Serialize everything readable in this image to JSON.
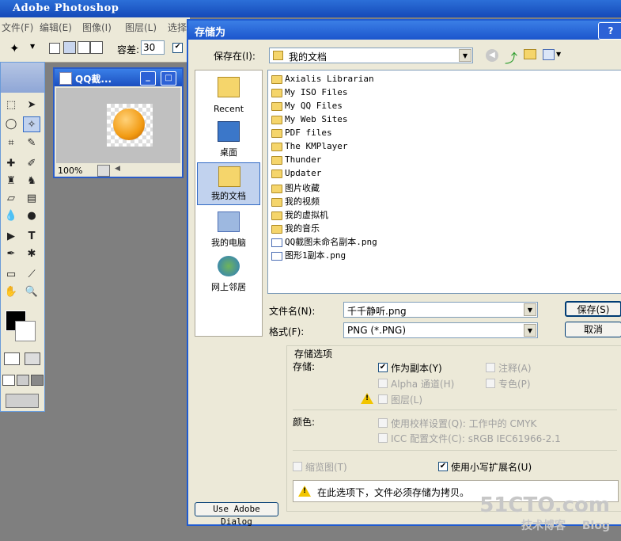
{
  "app": {
    "title": "Adobe Photoshop",
    "menu": [
      "文件(F)",
      "编辑(E)",
      "图像(I)",
      "图层(L)",
      "选择"
    ],
    "options": {
      "tolerance_label": "容差:",
      "tolerance_value": "30"
    }
  },
  "document_window": {
    "title": "QQ截...",
    "zoom": "100%"
  },
  "dialog": {
    "title": "存储为",
    "help_button": "?",
    "save_in_label": "保存在(I):",
    "save_in_value": "我的文档",
    "places": [
      {
        "label": "Recent",
        "icon": "recent-folder-icon"
      },
      {
        "label": "桌面",
        "icon": "desktop-icon"
      },
      {
        "label": "我的文档",
        "icon": "my-documents-icon"
      },
      {
        "label": "我的电脑",
        "icon": "my-computer-icon"
      },
      {
        "label": "网上邻居",
        "icon": "network-places-icon"
      }
    ],
    "files": [
      {
        "name": "Axialis Librarian",
        "type": "folder"
      },
      {
        "name": "My ISO Files",
        "type": "folder"
      },
      {
        "name": "My QQ Files",
        "type": "folder"
      },
      {
        "name": "My Web Sites",
        "type": "folder"
      },
      {
        "name": "PDF files",
        "type": "folder"
      },
      {
        "name": "The KMPlayer",
        "type": "folder"
      },
      {
        "name": "Thunder",
        "type": "folder"
      },
      {
        "name": "Updater",
        "type": "folder"
      },
      {
        "name": "图片收藏",
        "type": "folder"
      },
      {
        "name": "我的视频",
        "type": "folder"
      },
      {
        "name": "我的虚拟机",
        "type": "folder"
      },
      {
        "name": "我的音乐",
        "type": "folder"
      },
      {
        "name": "QQ截图未命名副本.png",
        "type": "png"
      },
      {
        "name": "图形1副本.png",
        "type": "png"
      }
    ],
    "filename_label": "文件名(N):",
    "filename_value": "千千静听.png",
    "format_label": "格式(F):",
    "format_value": "PNG (*.PNG)",
    "save_button": "保存(S)",
    "cancel_button": "取消",
    "options_group_title": "存储选项",
    "save_label": "存储:",
    "opt_as_copy": "作为副本(Y)",
    "opt_annotations": "注释(A)",
    "opt_alpha": "Alpha 通道(H)",
    "opt_spot": "专色(P)",
    "opt_layers": "图层(L)",
    "color_label": "颜色:",
    "opt_proof": "使用校样设置(Q): 工作中的 CMYK",
    "opt_icc": "ICC 配置文件(C): sRGB IEC61966-2.1",
    "opt_thumbnail": "缩览图(T)",
    "opt_lowercase": "使用小写扩展名(U)",
    "warning_text": "在此选项下，文件必须存储为拷贝。",
    "adobe_dialog_button": "Use Adobe Dialog",
    "accent": "#1f5bd1"
  },
  "watermark": {
    "line1": "51CTO.com",
    "line2": "技术博客",
    "line3": "Blog"
  }
}
